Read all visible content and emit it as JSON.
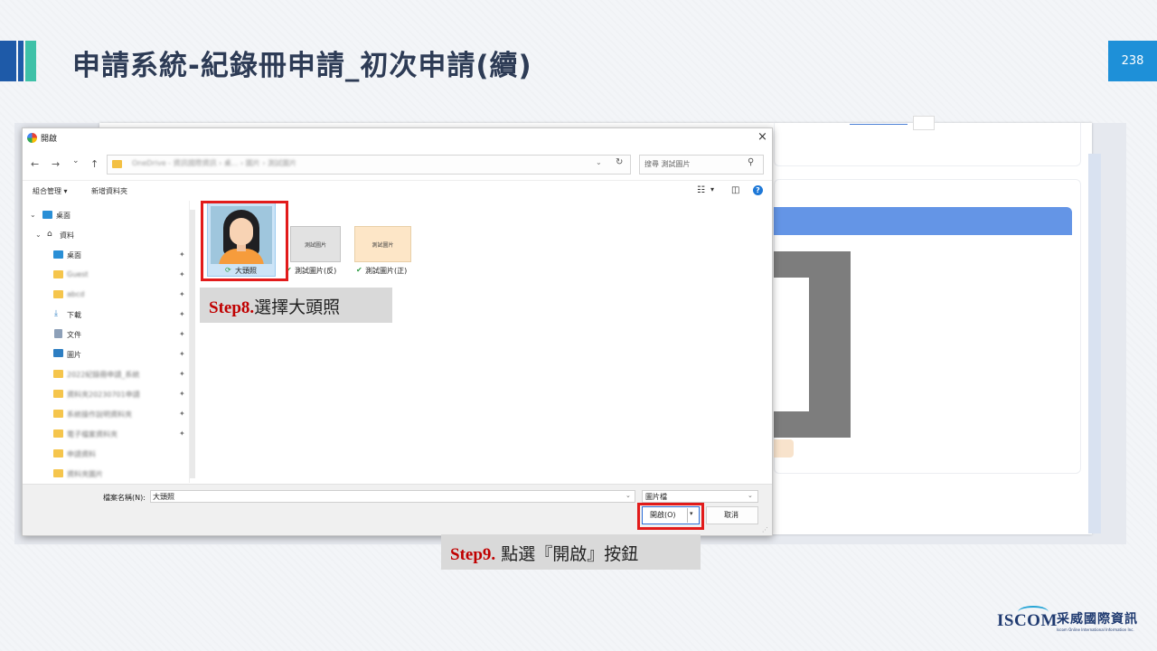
{
  "slide": {
    "title": "申請系統-紀錄冊申請_初次申請(續)",
    "page_number": "238"
  },
  "dialog": {
    "title": "開啟",
    "close_icon": "×",
    "nav": {
      "back": "←",
      "forward": "→",
      "recent": "⌄",
      "up": "↑"
    },
    "address_path": "OneDrive - 資訊國際資訊 › 桌... › 圖片 › 測試圖片",
    "search_placeholder": "搜尋 測試圖片",
    "toolbar": {
      "organize": "組合管理 ▾",
      "new_folder": "新增資料夾"
    },
    "nav_pane": {
      "items": [
        {
          "label": "桌面",
          "blurred": false
        },
        {
          "label": "資料",
          "blurred": false
        },
        {
          "label": "桌面",
          "blurred": false
        },
        {
          "label": "Guest",
          "blurred": true
        },
        {
          "label": "abcd",
          "blurred": true
        },
        {
          "label": "下載",
          "blurred": false
        },
        {
          "label": "文件",
          "blurred": false
        },
        {
          "label": "圖片",
          "blurred": false
        },
        {
          "label": "2022紀錄冊申請_系統",
          "blurred": true
        },
        {
          "label": "資料夾20230701申請",
          "blurred": true
        },
        {
          "label": "系統操作說明資料夾",
          "blurred": true
        },
        {
          "label": "電子檔案資料夾",
          "blurred": true
        },
        {
          "label": "申請資料",
          "blurred": true
        },
        {
          "label": "資料夾圖片",
          "blurred": true
        }
      ]
    },
    "files": [
      {
        "label": "大頭照",
        "thumb_text": ""
      },
      {
        "label": "測試圖片(反)",
        "thumb_text": "測試圖片"
      },
      {
        "label": "測試圖片(正)",
        "thumb_text": "測試圖片"
      }
    ],
    "filename_label": "檔案名稱(N):",
    "filename_value": "大頭照",
    "filetype_value": "圖片檔",
    "open_button": "開啟(O)",
    "cancel_button": "取消"
  },
  "callouts": {
    "step8_label": "Step8.",
    "step8_text": "選擇大頭照",
    "step9_label": "Step9.",
    "step9_text": "點選『開啟』按鈕"
  },
  "logo": {
    "brand": "ISCOM",
    "cn_name": "采威國際資訊",
    "en_name": "Iscom Online International Information Inc."
  },
  "colors": {
    "accent_blue": "#1e90d8",
    "highlight_red": "#e21b1b",
    "step_red": "#c00000"
  }
}
